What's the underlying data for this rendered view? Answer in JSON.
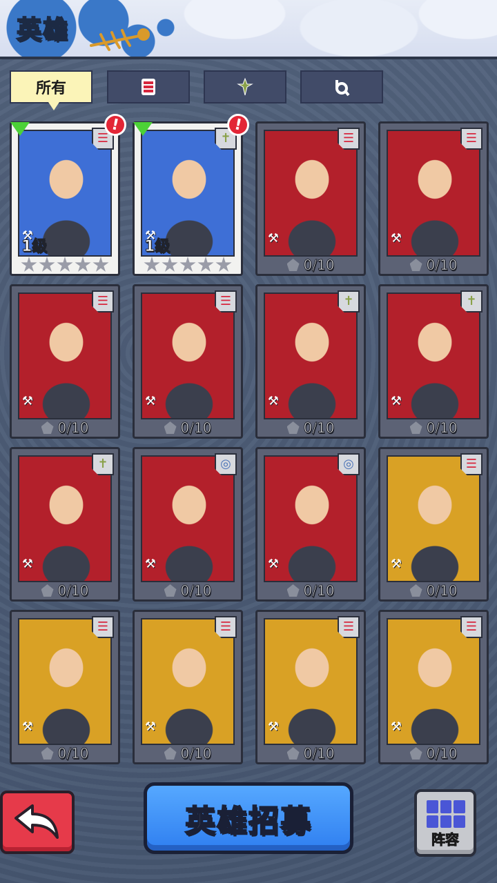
{
  "header": {
    "title": "英雄"
  },
  "tabs": [
    {
      "label": "所有",
      "icon": "all"
    },
    {
      "label": "",
      "icon": "tank-class-icon"
    },
    {
      "label": "",
      "icon": "sniper-class-icon"
    },
    {
      "label": "",
      "icon": "tech-class-icon"
    }
  ],
  "heroes": [
    {
      "state": "owned",
      "level": "1级",
      "class": "tank",
      "portrait": "blue",
      "stars": 5,
      "alert": "!"
    },
    {
      "state": "owned",
      "level": "1级",
      "class": "sniper",
      "portrait": "blue",
      "stars": 5,
      "alert": "!"
    },
    {
      "state": "locked",
      "progress": "0/10",
      "class": "tank",
      "portrait": "red"
    },
    {
      "state": "locked",
      "progress": "0/10",
      "class": "tank",
      "portrait": "red"
    },
    {
      "state": "locked",
      "progress": "0/10",
      "class": "tank",
      "portrait": "red"
    },
    {
      "state": "locked",
      "progress": "0/10",
      "class": "tank",
      "portrait": "red"
    },
    {
      "state": "locked",
      "progress": "0/10",
      "class": "sniper",
      "portrait": "red"
    },
    {
      "state": "locked",
      "progress": "0/10",
      "class": "sniper",
      "portrait": "red"
    },
    {
      "state": "locked",
      "progress": "0/10",
      "class": "sniper",
      "portrait": "red"
    },
    {
      "state": "locked",
      "progress": "0/10",
      "class": "tech",
      "portrait": "red"
    },
    {
      "state": "locked",
      "progress": "0/10",
      "class": "tech",
      "portrait": "red"
    },
    {
      "state": "locked",
      "progress": "0/10",
      "class": "tank",
      "portrait": "gold"
    },
    {
      "state": "locked",
      "progress": "0/10",
      "class": "tank",
      "portrait": "gold"
    },
    {
      "state": "locked",
      "progress": "0/10",
      "class": "tank",
      "portrait": "gold"
    },
    {
      "state": "locked",
      "progress": "0/10",
      "class": "tank",
      "portrait": "gold"
    },
    {
      "state": "locked",
      "progress": "0/10",
      "class": "tank",
      "portrait": "gold"
    }
  ],
  "footer": {
    "recruit_label": "英雄招募",
    "lineup_label": "阵容"
  },
  "colors": {
    "blue_portrait": "#3e6fd6",
    "red_portrait": "#b3202b",
    "gold_portrait": "#d9a125",
    "tank": "#d7263d",
    "sniper": "#8aa14a",
    "tech": "#4a73b8"
  }
}
